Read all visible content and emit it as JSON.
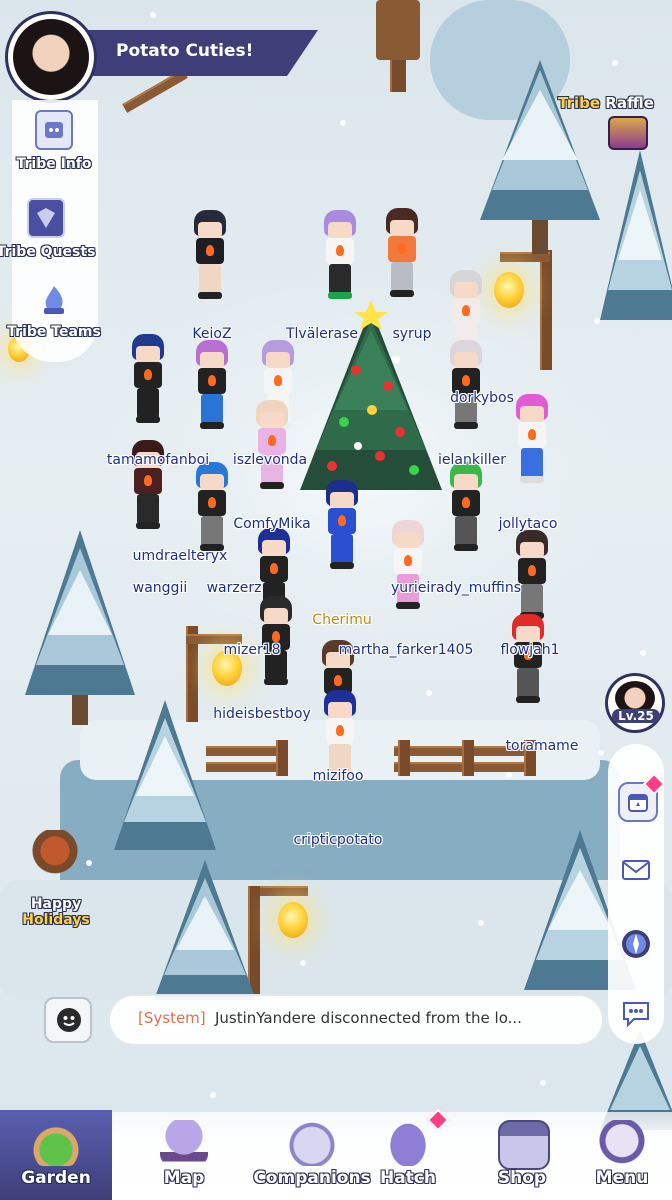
{
  "tribe": {
    "name": "Potato Cuties!",
    "avatar_icon": "player-avatar-portrait"
  },
  "sidebar": {
    "items": [
      {
        "label": "Tribe Info",
        "icon": "scroll-icon"
      },
      {
        "label": "Tribe Quests",
        "icon": "quest-shield-icon"
      },
      {
        "label": "Tribe Teams",
        "icon": "flame-team-icon"
      }
    ]
  },
  "tribe_raffle": {
    "label_1": "Tribe",
    "label_2": "Raffle",
    "icon": "raffle-mask-icon"
  },
  "players": [
    {
      "name": "KeioZ"
    },
    {
      "name": "Tlvälerase"
    },
    {
      "name": "syrup"
    },
    {
      "name": "dorkybos"
    },
    {
      "name": "tamamofanboi"
    },
    {
      "name": "iszlevonda"
    },
    {
      "name": "ielankiller"
    },
    {
      "name": "ComfyMika"
    },
    {
      "name": "jollytaco"
    },
    {
      "name": "umdraelteryx"
    },
    {
      "name": "wanggii"
    },
    {
      "name": "warzerz"
    },
    {
      "name": "yurieirady_muffins"
    },
    {
      "name": "Cherimu"
    },
    {
      "name": "mizer18"
    },
    {
      "name": "martha_farker1405"
    },
    {
      "name": "flowjah1"
    },
    {
      "name": "hideisbestboy"
    },
    {
      "name": "toramame"
    },
    {
      "name": "mizifoo"
    },
    {
      "name": "cripticpotato"
    }
  ],
  "level": {
    "text": "Lv.25",
    "icon": "player-level-portrait"
  },
  "right_panel": {
    "buttons": [
      {
        "icon": "calendar-icon",
        "badge": true
      },
      {
        "icon": "mail-icon",
        "badge": false
      },
      {
        "icon": "compass-icon",
        "badge": false
      },
      {
        "icon": "chat-bubble-icon",
        "badge": false
      }
    ]
  },
  "event": {
    "line_1": "Happy",
    "line_2": "Holidays",
    "icon": "happy-holidays-icon"
  },
  "chat": {
    "system_tag": "[System]",
    "message": "JustinYandere disconnected from the lo...",
    "emoji_icon": "emoji-icon"
  },
  "nav": {
    "items": [
      {
        "label": "Garden",
        "icon": "garden-island-icon",
        "active": true
      },
      {
        "label": "Map",
        "icon": "balloon-map-icon",
        "active": false
      },
      {
        "label": "Companions",
        "icon": "companions-icon",
        "active": false
      },
      {
        "label": "Hatch",
        "icon": "hatch-egg-icon",
        "active": false
      },
      {
        "label": "Shop",
        "icon": "shop-stall-icon",
        "active": false
      },
      {
        "label": "Menu",
        "icon": "menu-character-icon",
        "active": false
      }
    ]
  },
  "colors": {
    "hud_navy": "#3e3f78",
    "name_blue": "#1e2f8a",
    "name_gold": "#c08a10",
    "system_orange": "#e56d4a",
    "badge_pink": "#ff3d87",
    "holidays_yellow": "#ffd24a"
  }
}
